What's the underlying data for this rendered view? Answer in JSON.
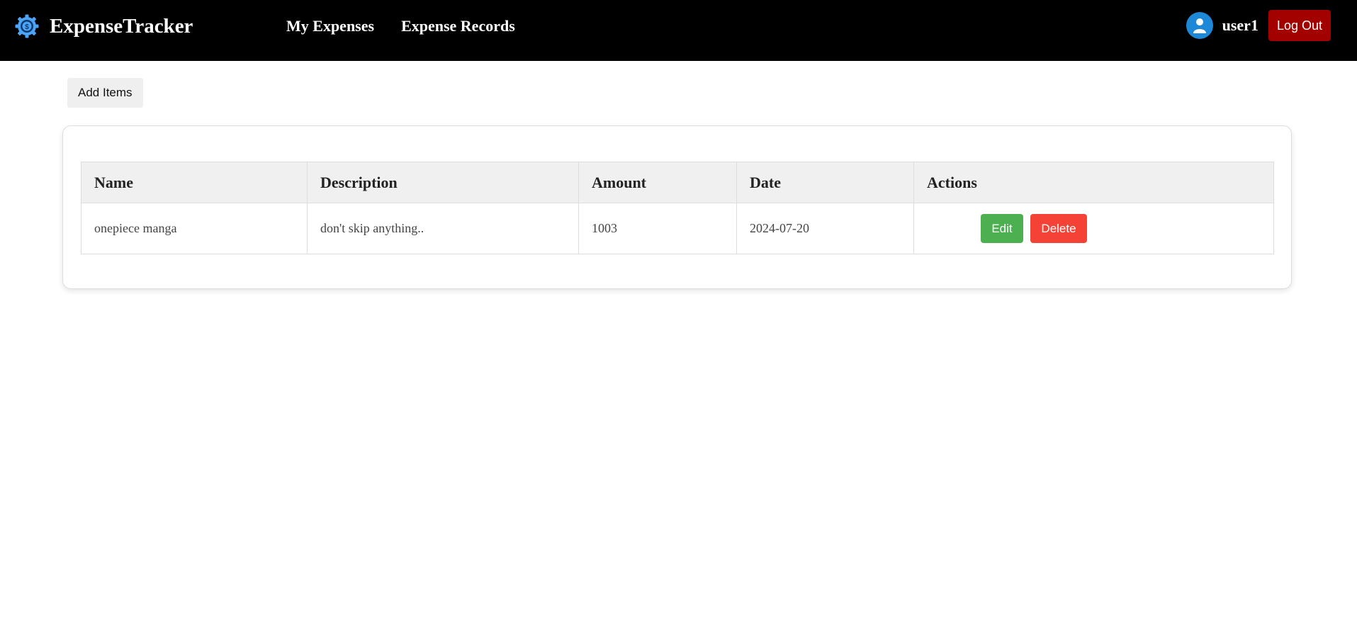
{
  "app": {
    "brand_name": "ExpenseTracker",
    "logo_icon": "gear-coin-icon"
  },
  "nav": {
    "links": [
      {
        "label": "My Expenses"
      },
      {
        "label": "Expense Records"
      }
    ]
  },
  "user": {
    "avatar_icon": "user-avatar-icon",
    "username": "user1",
    "logout_label": "Log Out"
  },
  "toolbar": {
    "add_label": "Add Items"
  },
  "table": {
    "columns": [
      "Name",
      "Description",
      "Amount",
      "Date",
      "Actions"
    ],
    "rows": [
      {
        "name": "onepiece manga",
        "description": "don't skip anything..",
        "amount": "1003",
        "date": "2024-07-20",
        "edit_label": "Edit",
        "delete_label": "Delete"
      }
    ]
  },
  "colors": {
    "navbar": "#000000",
    "logout": "#a30000",
    "edit": "#4caf50",
    "delete": "#f44336",
    "avatar": "#1e88d8",
    "logo": "#4da3f5"
  }
}
